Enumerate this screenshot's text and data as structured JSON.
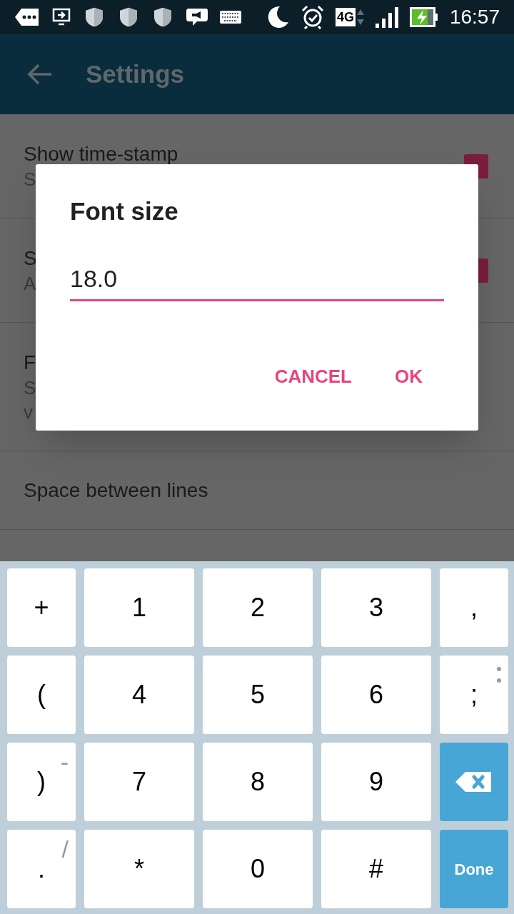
{
  "status_bar": {
    "network": "4G",
    "time": "16:57"
  },
  "app_bar": {
    "title": "Settings"
  },
  "settings": [
    {
      "kind": "checkbox",
      "title": "Show time-stamp",
      "subtitle_lines": [
        "S"
      ],
      "checked": true
    },
    {
      "kind": "checkbox",
      "title": "S",
      "subtitle_lines": [
        "A"
      ],
      "checked": true
    },
    {
      "kind": "text",
      "title": "F",
      "subtitle_lines": [
        "S",
        "v"
      ]
    },
    {
      "kind": "text",
      "title": "Space between lines"
    }
  ],
  "dialog": {
    "title": "Font size",
    "value": "18.0",
    "buttons": [
      "CANCEL",
      "OK"
    ]
  },
  "keyboard": {
    "rows": [
      [
        {
          "kind": "char",
          "label": "+"
        },
        {
          "kind": "char",
          "label": "1"
        },
        {
          "kind": "char",
          "label": "2"
        },
        {
          "kind": "char",
          "label": "3"
        },
        {
          "kind": "char",
          "label": ","
        }
      ],
      [
        {
          "kind": "char",
          "label": "("
        },
        {
          "kind": "char",
          "label": "4"
        },
        {
          "kind": "char",
          "label": "5"
        },
        {
          "kind": "char",
          "label": "6"
        },
        {
          "kind": "more",
          "label": ";"
        }
      ],
      [
        {
          "kind": "char",
          "label": ")",
          "hint": "-"
        },
        {
          "kind": "char",
          "label": "7"
        },
        {
          "kind": "char",
          "label": "8"
        },
        {
          "kind": "char",
          "label": "9"
        },
        {
          "kind": "backspace"
        }
      ],
      [
        {
          "kind": "char",
          "label": ".",
          "hint": "/"
        },
        {
          "kind": "char",
          "label": "*"
        },
        {
          "kind": "char",
          "label": "0"
        },
        {
          "kind": "char",
          "label": "#"
        },
        {
          "kind": "done",
          "label": "Done"
        }
      ]
    ]
  }
}
